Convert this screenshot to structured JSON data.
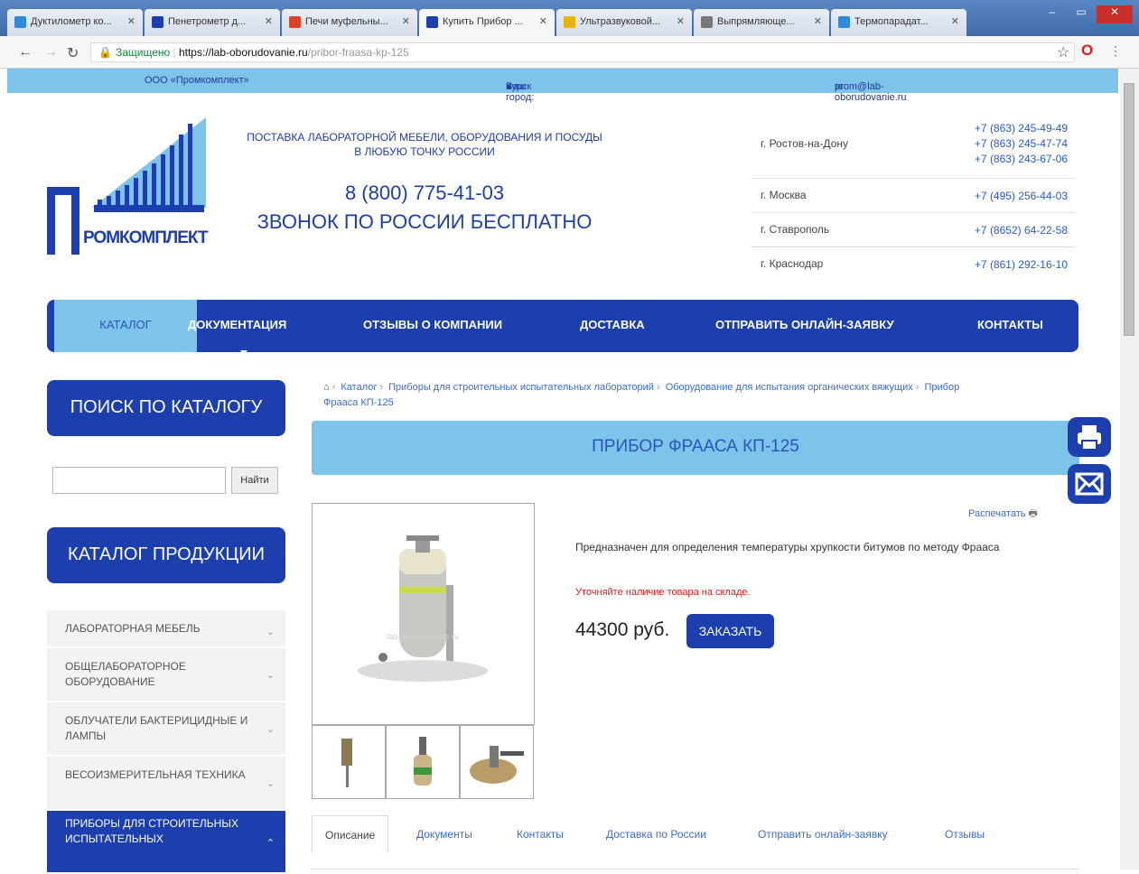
{
  "browser": {
    "tabs": [
      {
        "title": "Дуктилометр ко...",
        "color": "#2f8ad8"
      },
      {
        "title": "Пенетрометр д...",
        "color": "#1c3fad"
      },
      {
        "title": "Печи муфельны...",
        "color": "#d9442b"
      },
      {
        "title": "Купить Прибор ...",
        "color": "#1c3fad"
      },
      {
        "title": "Ультразвуковой...",
        "color": "#e8b300"
      },
      {
        "title": "Выпрямляюще...",
        "color": "#777777"
      },
      {
        "title": "Термопарадат...",
        "color": "#2f8ad8"
      }
    ],
    "url_secure": "Защищено",
    "url_host": "https://lab-oborudovanie.ru",
    "url_path": "/pribor-fraasa-kp-125",
    "nav_icons": [
      "back-arrow-icon",
      "forward-arrow-icon",
      "reload-icon"
    ]
  },
  "infobar": {
    "company": "ООО «Промкомплект»",
    "city_label": "Ваш город:",
    "city": "Курск",
    "email": "prom@lab-oborudovanie.ru"
  },
  "header": {
    "logo_text": "РОМКОМПЛЕКТ",
    "tagline": "ПОСТАВКА ЛАБОРАТОРНОЙ МЕБЕЛИ, ОБОРУДОВАНИЯ И ПОСУДЫ В ЛЮБУЮ ТОЧКУ РОССИИ",
    "phone": "8 (800) 775-41-03",
    "phone_note": "ЗВОНОК ПО РОССИИ БЕСПЛАТНО",
    "contacts": [
      {
        "city": "г. Ростов-на-Дону",
        "phones": [
          "+7 (863) 245-49-49",
          "+7 (863) 245-47-74",
          "+7 (863) 243-67-06"
        ]
      },
      {
        "city": "г. Москва",
        "phones": [
          "+7 (495) 256-44-03"
        ]
      },
      {
        "city": "г. Ставрополь",
        "phones": [
          "+7 (8652) 64-22-58"
        ]
      },
      {
        "city": "г. Краснодар",
        "phones": [
          "+7 (861) 292-16-10"
        ]
      }
    ]
  },
  "mainnav": {
    "items": [
      "КАТАЛОГ",
      "ДОКУМЕНТАЦИЯ",
      "ОТЗЫВЫ О КОМПАНИИ",
      "ДОСТАВКА",
      "ОТПРАВИТЬ ОНЛАЙН-ЗАЯВКУ",
      "КОНТАКТЫ"
    ]
  },
  "sidebar": {
    "search_title": "ПОИСК ПО КАТАЛОГУ",
    "search_button": "Найти",
    "search_value": "",
    "catalog_title": "КАТАЛОГ ПРОДУКЦИИ",
    "categories": [
      "ЛАБОРАТОРНАЯ МЕБЕЛЬ",
      "ОБЩЕЛАБОРАТОРНОЕ ОБОРУДОВАНИЕ",
      "ОБЛУЧАТЕЛИ БАКТЕРИЦИДНЫЕ И ЛАМПЫ",
      "ВЕСОИЗМЕРИТЕЛЬНАЯ ТЕХНИКА",
      "ПРИБОРЫ ДЛЯ СТРОИТЕЛЬНЫХ ИСПЫТАТЕЛЬНЫХ"
    ]
  },
  "breadcrumb": {
    "items": [
      "Каталог",
      "Приборы для строительных испытательных лабораторий",
      "Оборудование для испытания органических вяжущих",
      "Прибор Фрааса КП-125"
    ]
  },
  "product": {
    "title": "ПРИБОР ФРААСА КП-125",
    "print_label": "Распечатать",
    "description": "Предназначен для определения температуры хрупкости битумов по методу Фрааса",
    "stock_note": "Уточняйте наличие товара на складе.",
    "price": "44300 руб.",
    "order_button": "ЗАКАЗАТЬ",
    "watermark": "lab-oborudovanie.ru"
  },
  "tabs": {
    "items": [
      "Описание",
      "Документы",
      "Контакты",
      "Доставка по России",
      "Отправить онлайн-заявку",
      "Отзывы"
    ]
  },
  "colors": {
    "brand_blue": "#1c3fad",
    "light_blue": "#7ec3ea",
    "link": "#3a6ed2",
    "alert": "#e0201f"
  }
}
